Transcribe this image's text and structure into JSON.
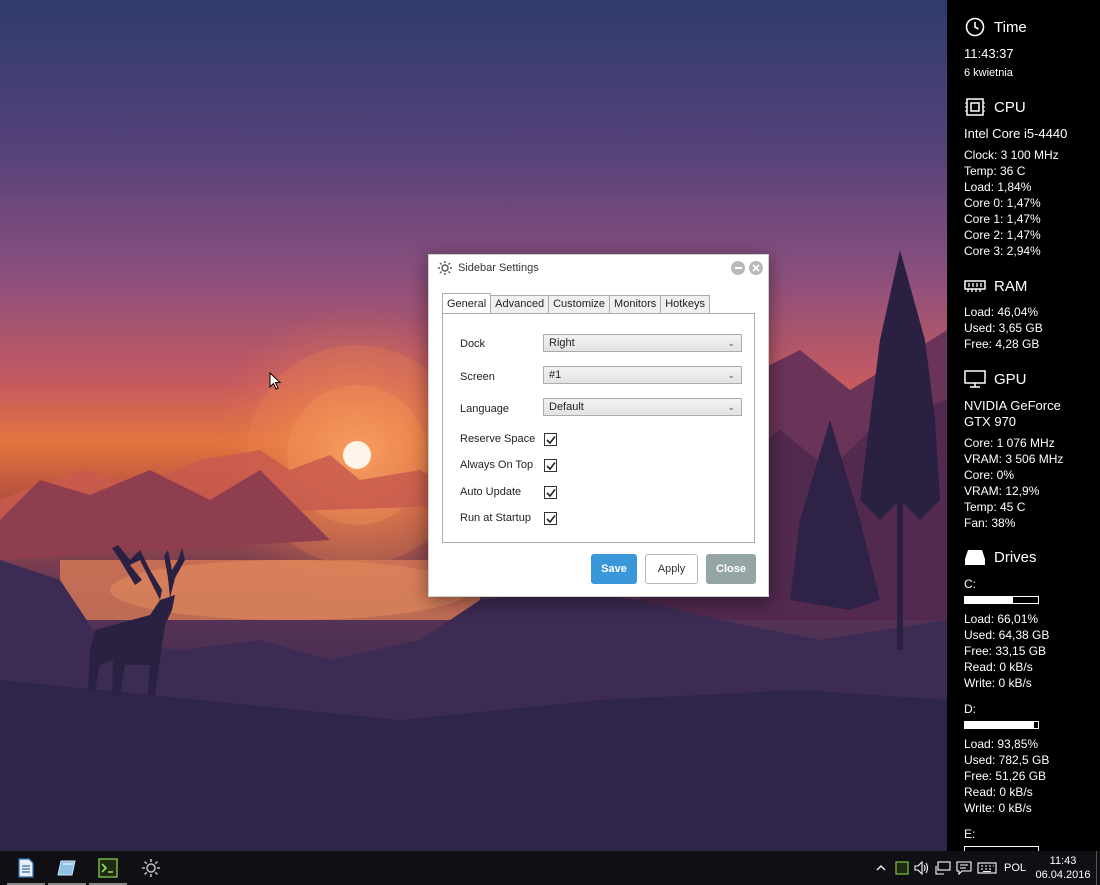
{
  "sidebar": {
    "time": {
      "title": "Time",
      "clock": "11:43:37",
      "date": "6 kwietnia"
    },
    "cpu": {
      "title": "CPU",
      "name": "Intel Core i5-4440",
      "lines": [
        "Clock: 3 100 MHz",
        "Temp: 36 C",
        "Load: 1,84%",
        "Core 0: 1,47%",
        "Core 1: 1,47%",
        "Core 2: 1,47%",
        "Core 3: 2,94%"
      ]
    },
    "ram": {
      "title": "RAM",
      "lines": [
        "Load: 46,04%",
        "Used: 3,65 GB",
        "Free: 4,28 GB"
      ]
    },
    "gpu": {
      "title": "GPU",
      "name": "NVIDIA GeForce GTX 970",
      "lines": [
        "Core: 1 076 MHz",
        "VRAM: 3 506 MHz",
        "Core: 0%",
        "VRAM: 12,9%",
        "Temp: 45 C",
        "Fan: 38%"
      ]
    },
    "drives": {
      "title": "Drives",
      "c": {
        "label": "C:",
        "load_fraction": 0.66,
        "lines": [
          "Load: 66,01%",
          "Used: 64,38 GB",
          "Free: 33,15 GB",
          "Read: 0 kB/s",
          "Write: 0 kB/s"
        ]
      },
      "d": {
        "label": "D:",
        "load_fraction": 0.94,
        "lines": [
          "Load: 93,85%",
          "Used: 782,5 GB",
          "Free: 51,26 GB",
          "Read: 0 kB/s",
          "Write: 0 kB/s"
        ]
      },
      "e": {
        "label": "E:"
      }
    }
  },
  "dialog": {
    "title": "Sidebar Settings",
    "tabs": [
      "General",
      "Advanced",
      "Customize",
      "Monitors",
      "Hotkeys"
    ],
    "active_tab": "General",
    "dock": {
      "label": "Dock",
      "value": "Right"
    },
    "screen": {
      "label": "Screen",
      "value": "#1"
    },
    "language": {
      "label": "Language",
      "value": "Default"
    },
    "checks": [
      {
        "label": "Reserve Space",
        "checked": true
      },
      {
        "label": "Always On Top",
        "checked": true
      },
      {
        "label": "Auto Update",
        "checked": true
      },
      {
        "label": "Run at Startup",
        "checked": true
      }
    ],
    "buttons": {
      "save": "Save",
      "apply": "Apply",
      "close": "Close"
    },
    "colors": {
      "save": "#3a97d9",
      "close": "#95a5a6"
    }
  },
  "taskbar": {
    "apps": [
      "notepad-icon",
      "file-icon",
      "terminal-icon",
      "settings-gear-icon"
    ],
    "language": "POL",
    "time": "11:43",
    "date": "06.04.2016"
  }
}
